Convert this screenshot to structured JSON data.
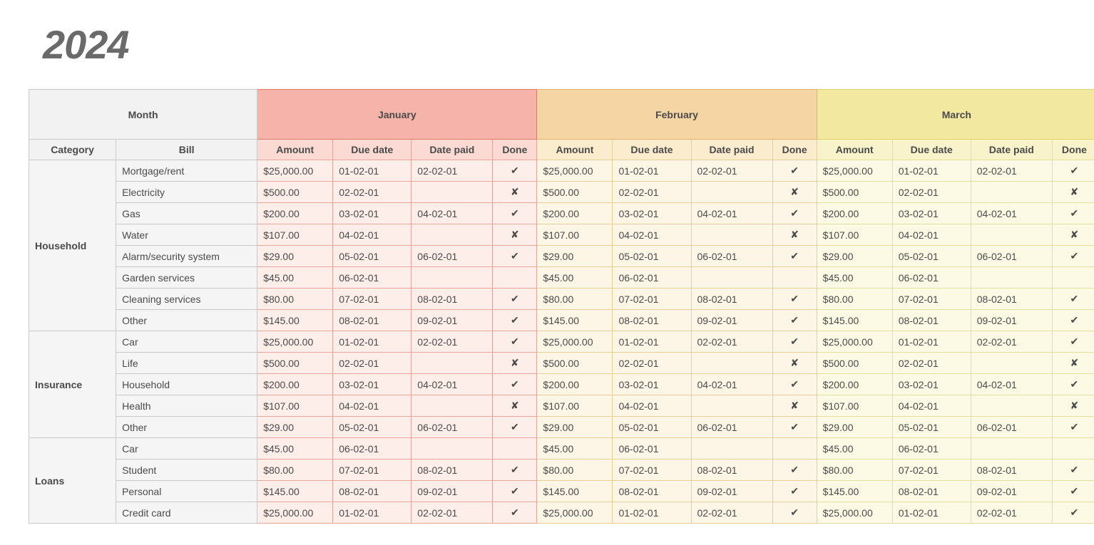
{
  "year": "2024",
  "labels": {
    "month": "Month",
    "category": "Category",
    "bill": "Bill",
    "amount": "Amount",
    "due": "Due date",
    "paid": "Date paid",
    "done": "Done"
  },
  "months": [
    "January",
    "February",
    "March"
  ],
  "check": "✔",
  "cross": "✘",
  "categories": [
    {
      "name": "Household",
      "bills": [
        {
          "name": "Mortgage/rent",
          "amount": "$25,000.00",
          "due": "01-02-01",
          "paid": "02-02-01",
          "done": "check"
        },
        {
          "name": "Electricity",
          "amount": "$500.00",
          "due": "02-02-01",
          "paid": "",
          "done": "cross"
        },
        {
          "name": "Gas",
          "amount": "$200.00",
          "due": "03-02-01",
          "paid": "04-02-01",
          "done": "check"
        },
        {
          "name": "Water",
          "amount": "$107.00",
          "due": "04-02-01",
          "paid": "",
          "done": "cross"
        },
        {
          "name": "Alarm/security system",
          "amount": "$29.00",
          "due": "05-02-01",
          "paid": "06-02-01",
          "done": "check"
        },
        {
          "name": "Garden services",
          "amount": "$45.00",
          "due": "06-02-01",
          "paid": "",
          "done": ""
        },
        {
          "name": "Cleaning services",
          "amount": "$80.00",
          "due": "07-02-01",
          "paid": "08-02-01",
          "done": "check"
        },
        {
          "name": "Other",
          "amount": "$145.00",
          "due": "08-02-01",
          "paid": "09-02-01",
          "done": "check"
        }
      ]
    },
    {
      "name": "Insurance",
      "bills": [
        {
          "name": "Car",
          "amount": "$25,000.00",
          "due": "01-02-01",
          "paid": "02-02-01",
          "done": "check"
        },
        {
          "name": "Life",
          "amount": "$500.00",
          "due": "02-02-01",
          "paid": "",
          "done": "cross"
        },
        {
          "name": "Household",
          "amount": "$200.00",
          "due": "03-02-01",
          "paid": "04-02-01",
          "done": "check"
        },
        {
          "name": "Health",
          "amount": "$107.00",
          "due": "04-02-01",
          "paid": "",
          "done": "cross"
        },
        {
          "name": "Other",
          "amount": "$29.00",
          "due": "05-02-01",
          "paid": "06-02-01",
          "done": "check"
        }
      ]
    },
    {
      "name": "Loans",
      "bills": [
        {
          "name": "Car",
          "amount": "$45.00",
          "due": "06-02-01",
          "paid": "",
          "done": ""
        },
        {
          "name": "Student",
          "amount": "$80.00",
          "due": "07-02-01",
          "paid": "08-02-01",
          "done": "check"
        },
        {
          "name": "Personal",
          "amount": "$145.00",
          "due": "08-02-01",
          "paid": "09-02-01",
          "done": "check"
        },
        {
          "name": "Credit card",
          "amount": "$25,000.00",
          "due": "01-02-01",
          "paid": "02-02-01",
          "done": "check"
        }
      ]
    }
  ]
}
